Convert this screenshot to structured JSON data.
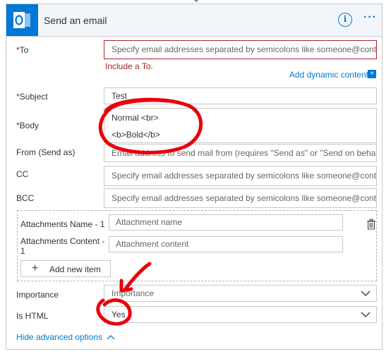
{
  "header": {
    "title": "Send an email",
    "info_label": "i",
    "more_label": "···",
    "logo_letter": "O"
  },
  "to": {
    "label": "To",
    "required_mark": "*",
    "placeholder": "Specify email addresses separated by semicolons like someone@contoso.com",
    "error": "Include a To."
  },
  "dynamic_content": {
    "label": "Add dynamic content",
    "icon": "plus-icon"
  },
  "subject": {
    "label": "Subject",
    "required_mark": "*",
    "value": "Test"
  },
  "body": {
    "label": "Body",
    "required_mark": "*",
    "line1": "Normal <br>",
    "line2": "<b>Bold</b>"
  },
  "from": {
    "label": "From (Send as)",
    "placeholder": "Email address to send mail from (requires \"Send as\" or \"Send on behalf of\" pe"
  },
  "cc": {
    "label": "CC",
    "placeholder": "Specify email addresses separated by semicolons like someone@contoso.com"
  },
  "bcc": {
    "label": "BCC",
    "placeholder": "Specify email addresses separated by semicolons like someone@contoso.com"
  },
  "attachments": {
    "name_label": "Attachments Name - 1",
    "name_placeholder": "Attachment name",
    "content_label_1": "Attachments Content -",
    "content_label_2": "1",
    "content_placeholder": "Attachment content",
    "add_button": "Add new item"
  },
  "importance": {
    "label": "Importance",
    "value": "Importance"
  },
  "is_html": {
    "label": "Is HTML",
    "value": "Yes"
  },
  "advanced": {
    "label": "Hide advanced options"
  },
  "colors": {
    "accent": "#0078d4",
    "error": "#a4262c",
    "annotation": "#e8000b"
  }
}
